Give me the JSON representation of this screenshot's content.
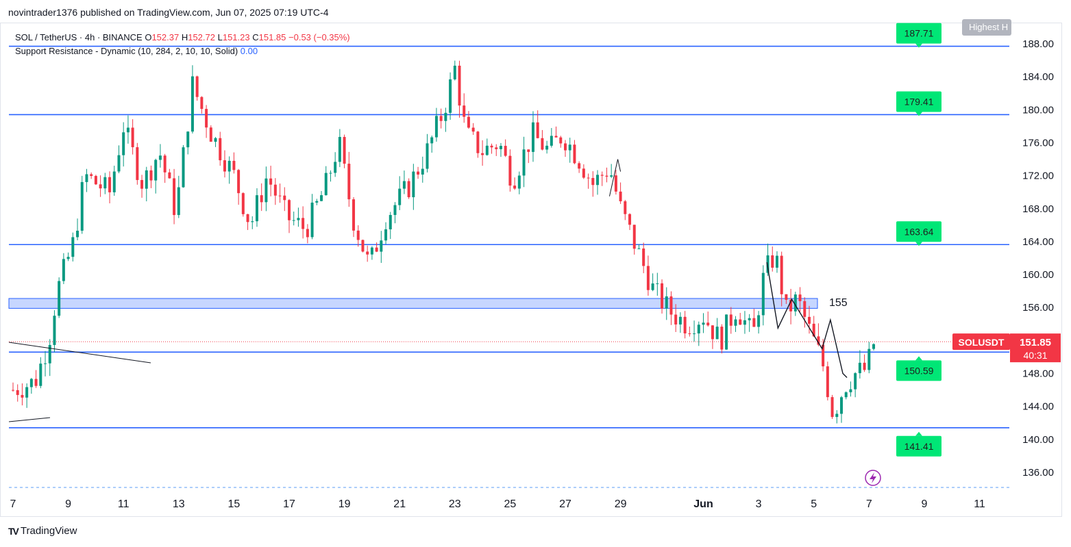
{
  "header": {
    "published_by": "novintrader1376 published on TradingView.com, Jun 07, 2025 07:19 UTC-4"
  },
  "legend": {
    "symbol": "SOL / TetherUS · 4h · BINANCE",
    "o_label": "O",
    "o": "152.37",
    "h_label": "H",
    "h": "152.72",
    "l_label": "L",
    "l": "151.23",
    "c_label": "C",
    "c": "151.85",
    "change": "−0.53 (−0.35%)",
    "indicator": "Support Resistance - Dynamic (10, 284, 2, 10, 10, Solid)",
    "indicator_value": "0.00"
  },
  "footer": {
    "logo": "TV",
    "brand": "TradingView"
  },
  "colors": {
    "up": "#22ab94",
    "up_body": "#089981",
    "down": "#f23645",
    "level_line": "#2962ff",
    "zone_fill": "#c6d6ff",
    "tag_green": "#00e676",
    "price_tag": "#f23645"
  },
  "chart_data": {
    "type": "candlestick",
    "symbol": "SOLUSDT",
    "timeframe": "4h",
    "ylim": [
      133.5,
      190.5
    ],
    "yticks": [
      "188.00",
      "184.00",
      "180.00",
      "176.00",
      "172.00",
      "168.00",
      "164.00",
      "160.00",
      "156.00",
      "152.00",
      "148.00",
      "144.00",
      "140.00",
      "136.00"
    ],
    "xticks": [
      {
        "label": "7",
        "day": 0
      },
      {
        "label": "9",
        "day": 2
      },
      {
        "label": "11",
        "day": 4
      },
      {
        "label": "13",
        "day": 6
      },
      {
        "label": "15",
        "day": 8
      },
      {
        "label": "17",
        "day": 10
      },
      {
        "label": "19",
        "day": 12
      },
      {
        "label": "21",
        "day": 14
      },
      {
        "label": "23",
        "day": 16
      },
      {
        "label": "25",
        "day": 18
      },
      {
        "label": "27",
        "day": 20
      },
      {
        "label": "29",
        "day": 22
      },
      {
        "label": "Jun",
        "day": 25
      },
      {
        "label": "3",
        "day": 27
      },
      {
        "label": "5",
        "day": 29
      },
      {
        "label": "7",
        "day": 31
      },
      {
        "label": "9",
        "day": 33
      },
      {
        "label": "11",
        "day": 35
      }
    ],
    "levels": [
      {
        "price": 187.71,
        "label": "187.71"
      },
      {
        "price": 179.41,
        "label": "179.41"
      },
      {
        "price": 163.64,
        "label": "163.64"
      },
      {
        "price": 150.59,
        "label": "150.59"
      },
      {
        "price": 141.41,
        "label": "141.41"
      }
    ],
    "zone": {
      "low": 155.9,
      "high": 157.1,
      "label": "155"
    },
    "highest_label": "Highest H",
    "last_price": {
      "symbol_tag": "SOLUSDT",
      "price": "151.85",
      "countdown": "40:31"
    },
    "key_closes": [
      {
        "day": 0.0,
        "close": 146.0
      },
      {
        "day": 0.8,
        "close": 147.0
      },
      {
        "day": 1.3,
        "close": 152.0
      },
      {
        "day": 1.6,
        "close": 158.0
      },
      {
        "day": 2.2,
        "close": 164.0
      },
      {
        "day": 2.6,
        "close": 172.0
      },
      {
        "day": 3.5,
        "close": 170.0
      },
      {
        "day": 4.0,
        "close": 178.0
      },
      {
        "day": 4.7,
        "close": 171.0
      },
      {
        "day": 5.3,
        "close": 175.0
      },
      {
        "day": 5.9,
        "close": 167.5
      },
      {
        "day": 6.5,
        "close": 183.0
      },
      {
        "day": 7.2,
        "close": 177.0
      },
      {
        "day": 8.0,
        "close": 172.0
      },
      {
        "day": 8.6,
        "close": 166.0
      },
      {
        "day": 9.2,
        "close": 172.0
      },
      {
        "day": 9.9,
        "close": 167.0
      },
      {
        "day": 10.6,
        "close": 165.5
      },
      {
        "day": 11.3,
        "close": 170.5
      },
      {
        "day": 11.8,
        "close": 176.0
      },
      {
        "day": 12.3,
        "close": 167.0
      },
      {
        "day": 12.9,
        "close": 161.0
      },
      {
        "day": 13.5,
        "close": 167.0
      },
      {
        "day": 14.3,
        "close": 170.5
      },
      {
        "day": 15.0,
        "close": 175.0
      },
      {
        "day": 15.6,
        "close": 180.0
      },
      {
        "day": 16.0,
        "close": 185.0
      },
      {
        "day": 16.4,
        "close": 177.0
      },
      {
        "day": 17.0,
        "close": 175.0
      },
      {
        "day": 17.6,
        "close": 176.0
      },
      {
        "day": 18.1,
        "close": 171.5
      },
      {
        "day": 18.8,
        "close": 177.0
      },
      {
        "day": 19.4,
        "close": 175.0
      },
      {
        "day": 19.9,
        "close": 177.0
      },
      {
        "day": 20.5,
        "close": 174.0
      },
      {
        "day": 21.0,
        "close": 171.0
      },
      {
        "day": 21.6,
        "close": 173.0
      },
      {
        "day": 22.0,
        "close": 168.0
      },
      {
        "day": 22.6,
        "close": 163.0
      },
      {
        "day": 23.2,
        "close": 158.0
      },
      {
        "day": 23.8,
        "close": 155.5
      },
      {
        "day": 24.4,
        "close": 154.0
      },
      {
        "day": 25.0,
        "close": 155.0
      },
      {
        "day": 25.6,
        "close": 152.0
      },
      {
        "day": 26.2,
        "close": 156.0
      },
      {
        "day": 26.8,
        "close": 152.5
      },
      {
        "day": 27.2,
        "close": 160.0
      },
      {
        "day": 27.6,
        "close": 162.5
      },
      {
        "day": 28.0,
        "close": 155.5
      },
      {
        "day": 28.4,
        "close": 157.0
      },
      {
        "day": 28.8,
        "close": 153.5
      },
      {
        "day": 29.3,
        "close": 149.5
      },
      {
        "day": 29.7,
        "close": 143.0
      },
      {
        "day": 30.1,
        "close": 146.5
      },
      {
        "day": 30.5,
        "close": 148.0
      },
      {
        "day": 30.9,
        "close": 148.5
      },
      {
        "day": 31.2,
        "close": 152.0
      },
      {
        "day": 31.3,
        "close": 151.85
      }
    ]
  }
}
